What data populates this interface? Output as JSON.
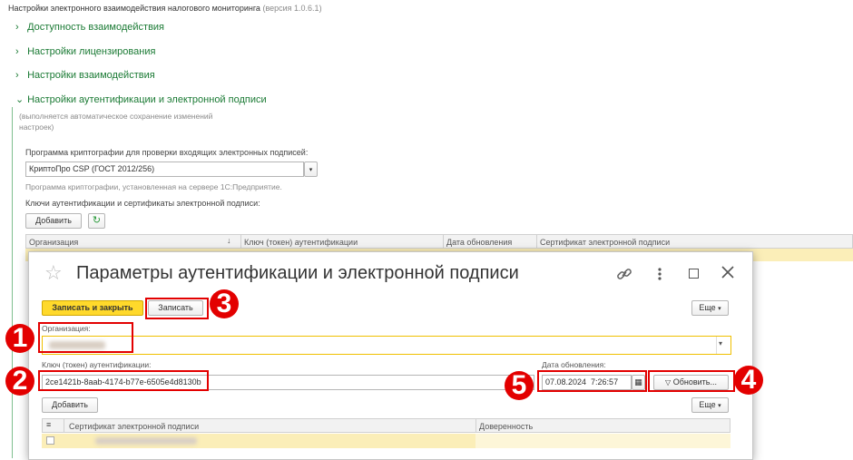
{
  "page": {
    "title": "Настройки электронного взаимодействия налогового мониторинга",
    "version": "(версия 1.0.6.1)"
  },
  "sections": [
    {
      "label": "Доступность взаимодействия",
      "expanded": false
    },
    {
      "label": "Настройки лицензирования",
      "expanded": false
    },
    {
      "label": "Настройки взаимодействия",
      "expanded": false
    },
    {
      "label": "Настройки аутентификации и электронной подписи",
      "expanded": true
    }
  ],
  "auth": {
    "autosave_note": "(выполняется автоматическое сохранение изменений настроек)",
    "crypto_label": "Программа криптографии для проверки входящих электронных подписей:",
    "crypto_value": "КриптоПро CSP (ГОСТ 2012/256)",
    "crypto_hint": "Программа криптографии, установленная на сервере 1С:Предприятие.",
    "keys_label": "Ключи аутентификации и сертификаты электронной подписи:",
    "add_button": "Добавить",
    "table_headers": [
      "Организация",
      "Ключ (токен) аутентификации",
      "Дата обновления",
      "Сертификат электронной подписи"
    ]
  },
  "dialog": {
    "title": "Параметры аутентификации и электронной подписи",
    "save_close": "Записать и закрыть",
    "save": "Записать",
    "more": "Еще",
    "org_label": "Организация:",
    "key_label": "Ключ (токен) аутентификации:",
    "key_value": "2ce1421b-8aab-4174-b77e-6505e4d8130b",
    "date_label": "Дата обновления:",
    "date_value": "07.08.2024  7:26:57",
    "refresh": "Обновить...",
    "add": "Добавить",
    "more2": "Еще",
    "cert_headers": [
      "Сертификат электронной подписи",
      "Доверенность"
    ]
  },
  "badges": [
    "1",
    "2",
    "3",
    "4",
    "5"
  ],
  "colors": {
    "accent_green": "#1a7a34",
    "annotation_red": "#e30000",
    "primary_button": "#ffd92b",
    "selected_row": "#fbeeb8"
  }
}
